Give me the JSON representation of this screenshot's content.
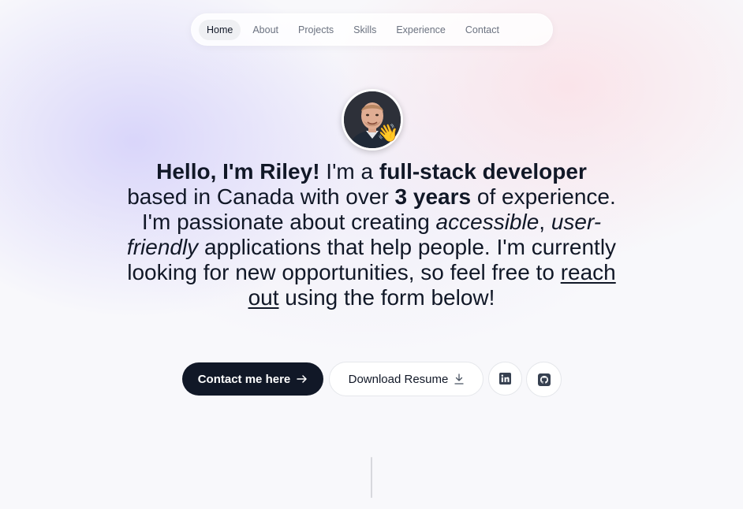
{
  "nav": {
    "items": [
      {
        "label": "Home",
        "active": true
      },
      {
        "label": "About",
        "active": false
      },
      {
        "label": "Projects",
        "active": false
      },
      {
        "label": "Skills",
        "active": false
      },
      {
        "label": "Experience",
        "active": false
      },
      {
        "label": "Contact",
        "active": false
      }
    ]
  },
  "hero": {
    "wave_emoji": "👋",
    "intro": {
      "greeting": "Hello, I'm Riley!",
      "t1": " I'm a ",
      "role": "full-stack developer",
      "t2": " based in Canada with over ",
      "years": "3 years",
      "t3": " of experience. I'm passionate about creating ",
      "adj1": "accessible",
      "t4": ", ",
      "adj2": "user-friendly",
      "t5": " applications that help people. I'm currently looking for new opportunities, so feel free to ",
      "link": "reach out",
      "t6": " using the form below!"
    }
  },
  "actions": {
    "contact_label": "Contact me here",
    "contact_icon": "arrow-right-icon",
    "resume_label": "Download Resume",
    "resume_icon": "download-icon",
    "linkedin_icon": "linkedin-icon",
    "github_icon": "github-icon"
  },
  "colors": {
    "primary_button": "#111827",
    "text": "#111827",
    "nav_inactive": "#6b7280"
  }
}
